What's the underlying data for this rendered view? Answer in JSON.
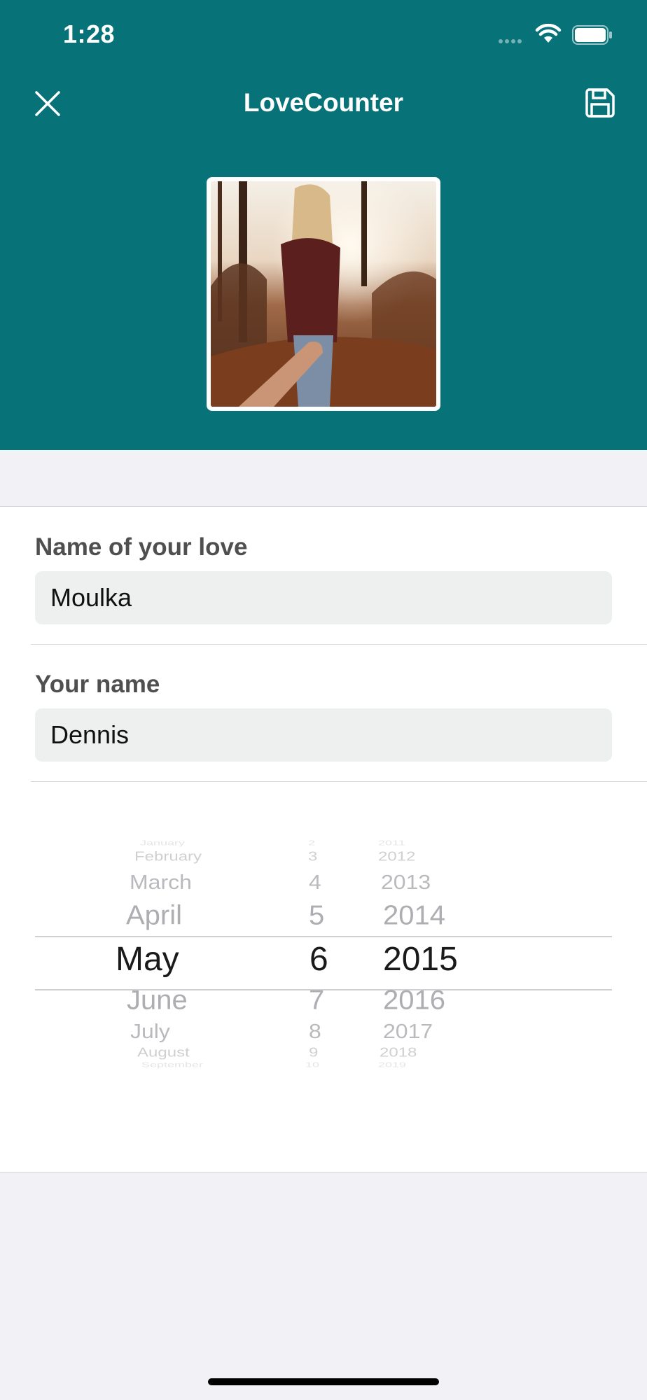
{
  "status_bar": {
    "time": "1:28"
  },
  "nav": {
    "title": "LoveCounter"
  },
  "form": {
    "love_name": {
      "label": "Name of your love",
      "value": "Moulka"
    },
    "your_name": {
      "label": "Your name",
      "value": "Dennis"
    }
  },
  "date_picker": {
    "months": [
      "January",
      "February",
      "March",
      "April",
      "May",
      "June",
      "July",
      "August",
      "September"
    ],
    "days": [
      "2",
      "3",
      "4",
      "5",
      "6",
      "7",
      "8",
      "9",
      "10"
    ],
    "years": [
      "2011",
      "2012",
      "2013",
      "2014",
      "2015",
      "2016",
      "2017",
      "2018",
      "2019"
    ],
    "selected": {
      "month": "May",
      "day": "6",
      "year": "2015"
    }
  },
  "colors": {
    "header": "#077278",
    "background": "#f1f1f6"
  }
}
